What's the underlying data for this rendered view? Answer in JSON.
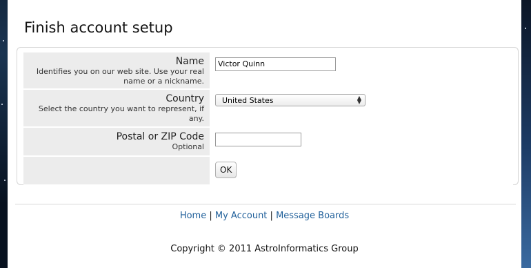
{
  "page": {
    "title": "Finish account setup"
  },
  "form": {
    "name": {
      "label": "Name",
      "help": "Identifies you on our web site. Use your real name or a nickname.",
      "value": "Victor Quinn"
    },
    "country": {
      "label": "Country",
      "help": "Select the country you want to represent, if any.",
      "selected": "United States"
    },
    "zip": {
      "label": "Postal or ZIP Code",
      "help": "Optional",
      "value": ""
    },
    "submit_label": "OK"
  },
  "footer": {
    "links": [
      "Home",
      "My Account",
      "Message Boards"
    ],
    "separator": "|",
    "copyright": "Copyright © 2011 AstroInformatics Group"
  },
  "icons": {
    "select_arrows": "up-down-arrows-icon"
  }
}
